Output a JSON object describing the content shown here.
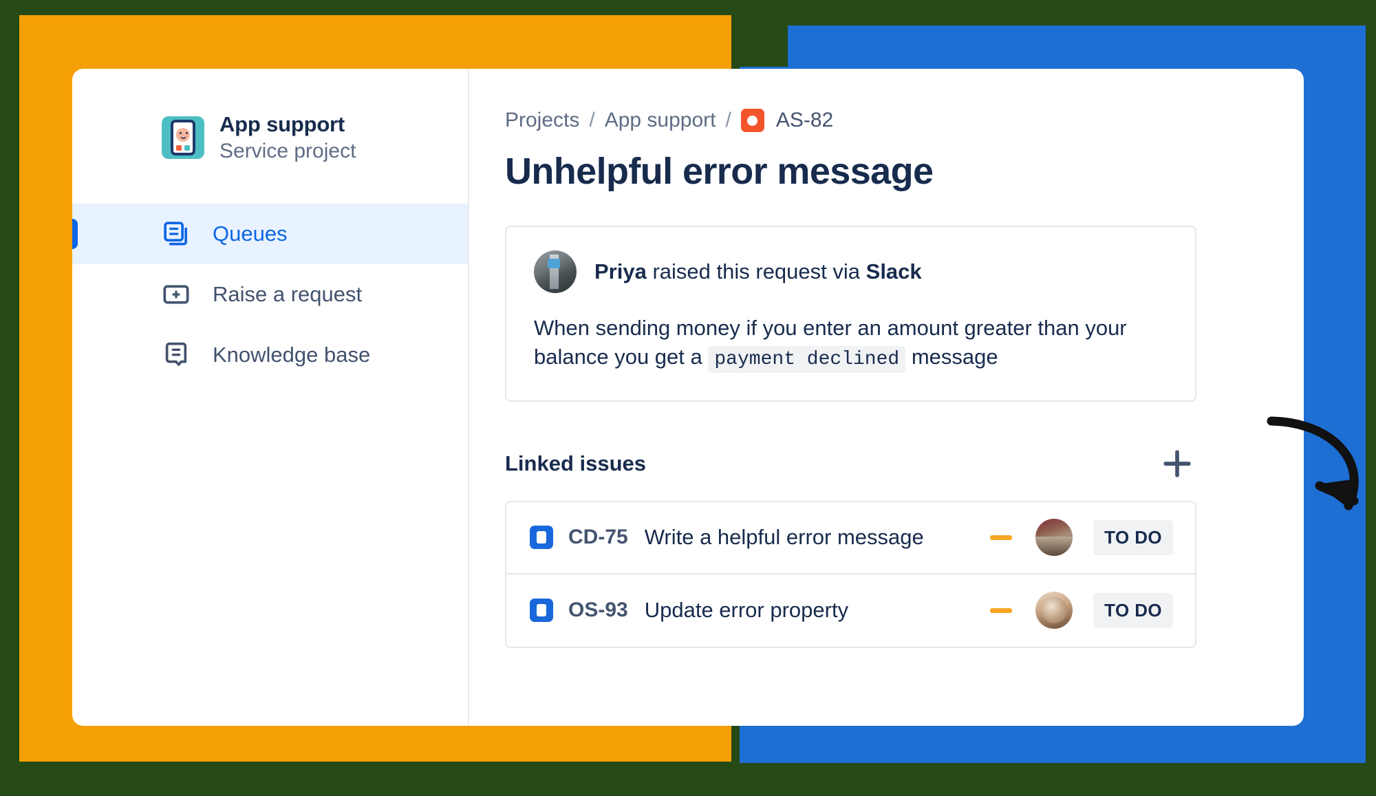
{
  "decor": {
    "background_color": "#254a16",
    "orange_color": "#f5a006",
    "blue_color": "#1d6fd4",
    "arrow_name": "curved-arrow-annotation"
  },
  "sidebar": {
    "project": {
      "name": "App support",
      "type": "Service project",
      "avatar_icon": "service-project-avatar"
    },
    "items": [
      {
        "label": "Queues",
        "icon": "queues-icon",
        "active": true
      },
      {
        "label": "Raise a request",
        "icon": "raise-request-icon",
        "active": false
      },
      {
        "label": "Knowledge base",
        "icon": "knowledge-base-icon",
        "active": false
      }
    ]
  },
  "content": {
    "breadcrumb": {
      "projects": "Projects",
      "sep1": "/",
      "project": "App support",
      "sep2": "/",
      "issue_key": "AS-82",
      "issue_type_icon": "support-request-icon",
      "issue_type_color": "#f4542c"
    },
    "title": "Unhelpful error message",
    "request": {
      "reporter": "Priya",
      "raised_text": "raised this request via",
      "channel": "Slack",
      "avatar_icon": "reporter-avatar",
      "body_part1": "When sending money if you enter an amount greater than your balance you get a",
      "body_code": "payment declined",
      "body_part2": "message"
    },
    "linked_issues": {
      "title": "Linked issues",
      "add_button_icon": "plus-icon",
      "rows": [
        {
          "key": "CD-75",
          "summary": "Write a helpful error message",
          "type_icon": "task-icon",
          "priority_icon": "priority-medium-icon",
          "avatar_icon": "assignee-avatar",
          "status": "TO DO"
        },
        {
          "key": "OS-93",
          "summary": "Update error property",
          "type_icon": "task-icon",
          "priority_icon": "priority-medium-icon",
          "avatar_icon": "assignee-avatar",
          "status": "TO DO"
        }
      ]
    }
  }
}
